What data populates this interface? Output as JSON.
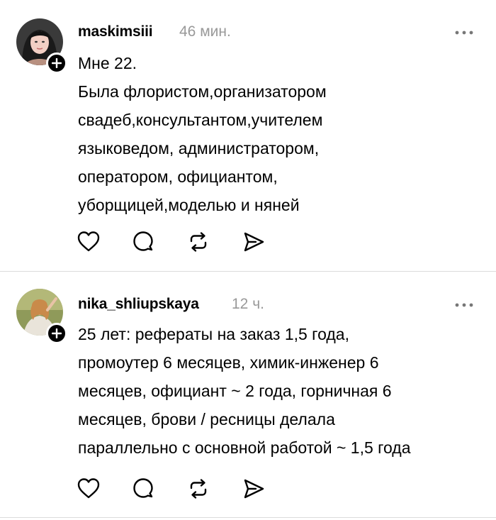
{
  "posts": [
    {
      "username": "maskimsiii",
      "time": "46 мин.",
      "lines": [
        "Мне 22.",
        "Была флористом,организатором",
        "свадеб,консультантом,учителем",
        "языковедом, администратором,",
        "оператором, официантом,",
        "уборщицей,моделью и няней"
      ]
    },
    {
      "username": "nika_shliupskaya",
      "time": "12 ч.",
      "lines": [
        "25 лет: рефераты на заказ 1,5 года,",
        "промоутер 6 месяцев, химик-инженер 6",
        "месяцев, официант ~ 2 года, горничная 6",
        "месяцев, брови / ресницы делала",
        "параллельно с основной работой ~ 1,5 года"
      ]
    }
  ],
  "icons": {
    "follow": "plus-icon",
    "more": "more-dots-icon",
    "like": "heart-icon",
    "reply": "comment-bubble-icon",
    "repost": "repost-arrows-icon",
    "share": "send-icon"
  },
  "colors": {
    "text": "#000000",
    "muted": "#999999",
    "separator": "#dcdcdc",
    "badge": "#000000"
  }
}
